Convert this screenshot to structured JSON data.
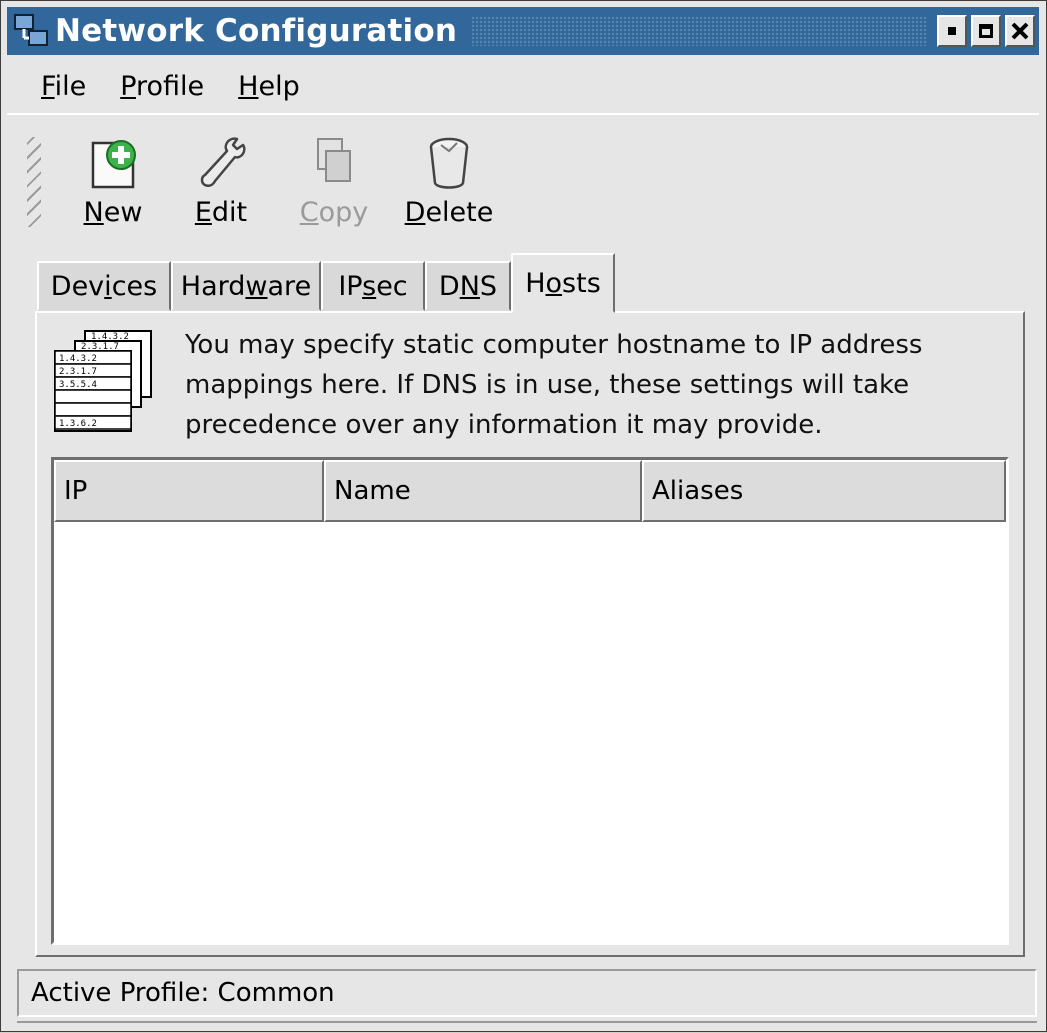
{
  "window": {
    "title": "Network Configuration"
  },
  "menubar": [
    {
      "first": "F",
      "rest": "ile"
    },
    {
      "first": "P",
      "rest": "rofile"
    },
    {
      "first": "H",
      "rest": "elp"
    }
  ],
  "toolbar": {
    "new": {
      "first": "N",
      "rest": "ew"
    },
    "edit": {
      "first": "E",
      "rest": "dit"
    },
    "copy": {
      "first": "C",
      "rest": "opy"
    },
    "delete": {
      "first": "D",
      "rest": "elete"
    }
  },
  "tabs": [
    {
      "pre": "Dev",
      "key": "i",
      "post": "ces"
    },
    {
      "pre": "Hard",
      "key": "w",
      "post": "are"
    },
    {
      "pre": "IP",
      "key": "s",
      "post": "ec"
    },
    {
      "pre": "D",
      "key": "N",
      "post": "S"
    },
    {
      "pre": "H",
      "key": "o",
      "post": "sts"
    }
  ],
  "hosts": {
    "info_text": "You may specify static computer hostname to IP address mappings here.  If DNS is in use, these settings will take precedence over any information it may provide.",
    "icon_lines": [
      "1.4.3.2",
      "2.3.1.7",
      "1.4.3.2",
      "2.3.1.7",
      "3.5.5.4",
      "1.3.6.2"
    ],
    "columns": [
      "IP",
      "Name",
      "Aliases"
    ]
  },
  "status": {
    "text": "Active Profile: Common"
  }
}
